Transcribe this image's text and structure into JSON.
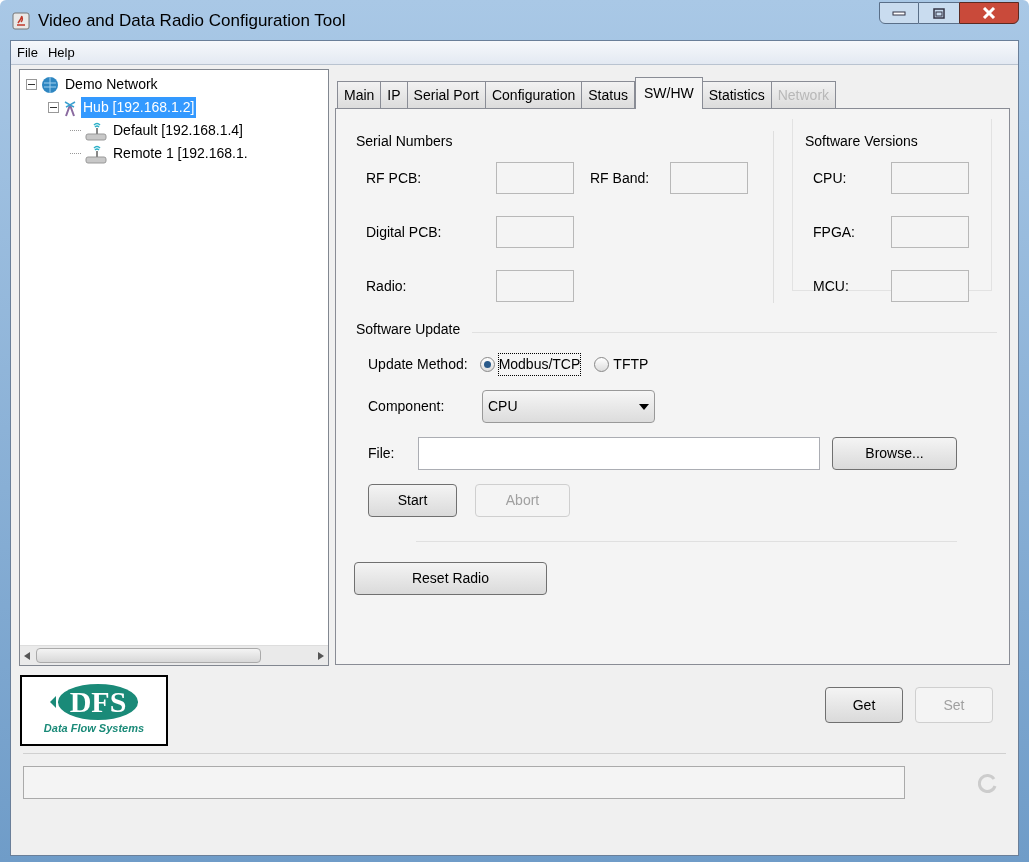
{
  "window": {
    "title": "Video and Data Radio Configuration Tool"
  },
  "menu": [
    "File",
    "Help"
  ],
  "tree": [
    {
      "label": "Demo Network",
      "kind": "network",
      "expanded": true,
      "selected": false,
      "children": [
        {
          "label": "Hub [192.168.1.2]",
          "kind": "hub",
          "expanded": true,
          "selected": true,
          "children": [
            {
              "label": "Default [192.168.1.4]",
              "kind": "radio",
              "selected": false
            },
            {
              "label": "Remote 1 [192.168.1.",
              "kind": "radio",
              "selected": false
            }
          ]
        }
      ]
    }
  ],
  "tabs": [
    {
      "label": "Main",
      "selected": false,
      "disabled": false
    },
    {
      "label": "IP",
      "selected": false,
      "disabled": false
    },
    {
      "label": "Serial Port",
      "selected": false,
      "disabled": false
    },
    {
      "label": "Configuration",
      "selected": false,
      "disabled": false
    },
    {
      "label": "Status",
      "selected": false,
      "disabled": false
    },
    {
      "label": "SW/HW",
      "selected": true,
      "disabled": false
    },
    {
      "label": "Statistics",
      "selected": false,
      "disabled": false
    },
    {
      "label": "Network",
      "selected": false,
      "disabled": true
    }
  ],
  "serial_numbers": {
    "title": "Serial Numbers",
    "fields": [
      {
        "label": "RF PCB:"
      },
      {
        "label": "RF Band:"
      },
      {
        "label": "Digital PCB:"
      },
      {
        "label": "Radio:"
      }
    ]
  },
  "software_versions": {
    "title": "Software Versions",
    "fields": [
      {
        "label": "CPU:"
      },
      {
        "label": "FPGA:"
      },
      {
        "label": "MCU:"
      }
    ]
  },
  "software_update": {
    "title": "Software Update",
    "method_label": "Update Method:",
    "methods": [
      {
        "label": "Modbus/TCP",
        "selected": true
      },
      {
        "label": "TFTP",
        "selected": false
      }
    ],
    "component_label": "Component:",
    "component": "CPU",
    "file_label": "File:",
    "buttons": [
      {
        "label": "Browse...",
        "disabled": false
      },
      {
        "label": "Start",
        "disabled": false
      },
      {
        "label": "Abort",
        "disabled": true
      }
    ]
  },
  "reset_button": {
    "label": "Reset Radio",
    "disabled": false
  },
  "logo": {
    "mark": "DFS",
    "tagline": "Data Flow Systems"
  },
  "actions": [
    {
      "label": "Get",
      "disabled": false
    },
    {
      "label": "Set",
      "disabled": true
    }
  ]
}
